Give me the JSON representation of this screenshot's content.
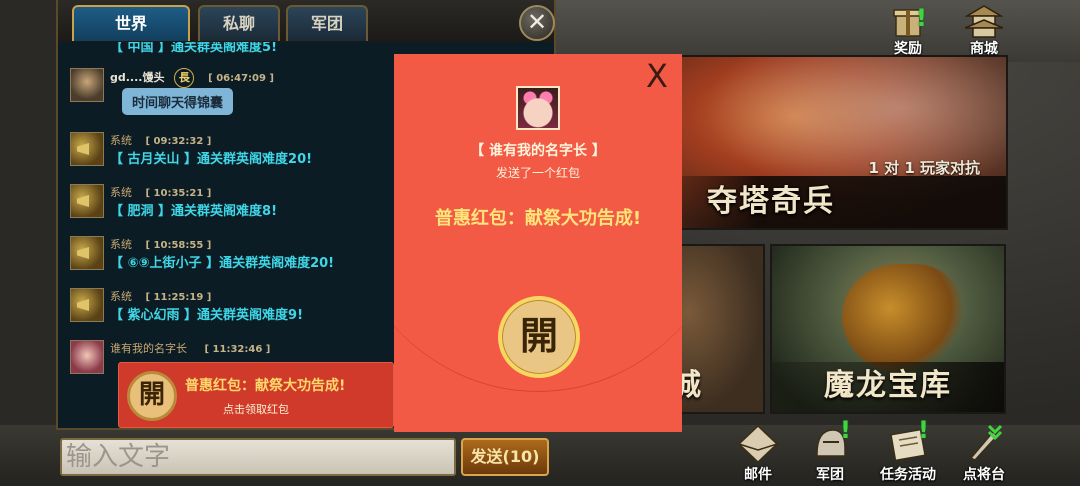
{
  "top_icons": [
    {
      "label": "奖励",
      "icon": "gift-icon",
      "alert": "!"
    },
    {
      "label": "商城",
      "icon": "pagoda-shop-icon"
    }
  ],
  "panels": {
    "pvp": {
      "subtitle": "1 对 1 玩家对抗",
      "title": "夺塔奇兵"
    },
    "mid": {
      "title": "城"
    },
    "dragon": {
      "title": "魔龙宝库"
    }
  },
  "bottom_icons": [
    {
      "label": "邮件",
      "icon": "mail-icon"
    },
    {
      "label": "军团",
      "icon": "legion-helmet-icon",
      "alert": "!"
    },
    {
      "label": "任务活动",
      "icon": "scroll-quest-icon",
      "alert": "!"
    },
    {
      "label": "点将台",
      "icon": "sword-general-icon"
    }
  ],
  "chat": {
    "tabs": [
      "世界",
      "私聊",
      "军团"
    ],
    "active_tab": "世界",
    "close": "✕",
    "messages": [
      {
        "type": "system",
        "text": "【  中国  】通关群英阁难度5!"
      },
      {
        "type": "user",
        "sender": "gd....馒头",
        "rank": "長",
        "time": "[ 06:47:09 ]",
        "bubble": "时间聊天得锦囊"
      },
      {
        "type": "system",
        "sender": "系统",
        "time": "[ 09:32:32 ]",
        "text": "【 古月关山 】通关群英阁难度20!"
      },
      {
        "type": "system",
        "sender": "系统",
        "time": "[ 10:35:21 ]",
        "text": "【 肥洞 】通关群英阁难度8!"
      },
      {
        "type": "system",
        "sender": "系统",
        "time": "[ 10:58:55 ]",
        "text": "【 ⑥⑨上街小子 】通关群英阁难度20!"
      },
      {
        "type": "system",
        "sender": "系统",
        "time": "[ 11:25:19 ]",
        "text": "【 紫心幻雨 】通关群英阁难度9!"
      },
      {
        "type": "redpacket",
        "sender": "谁有我的名字长",
        "time": "[ 11:32:46 ]"
      }
    ],
    "redpacket_card": {
      "coin": "開",
      "blessing": "普惠红包：献祭大功告成!",
      "action": "点击领取红包"
    },
    "input_placeholder": "输入文字",
    "send_label": "发送(10)"
  },
  "modal": {
    "close": "X",
    "sender": "【 谁有我的名字长 】",
    "sent_text": "发送了一个红包",
    "blessing": "普惠红包：献祭大功告成!",
    "open_label": "開",
    "colors": {
      "background": "#f25a45",
      "blessing": "#ffe47a",
      "coin": "#e9c683"
    }
  }
}
